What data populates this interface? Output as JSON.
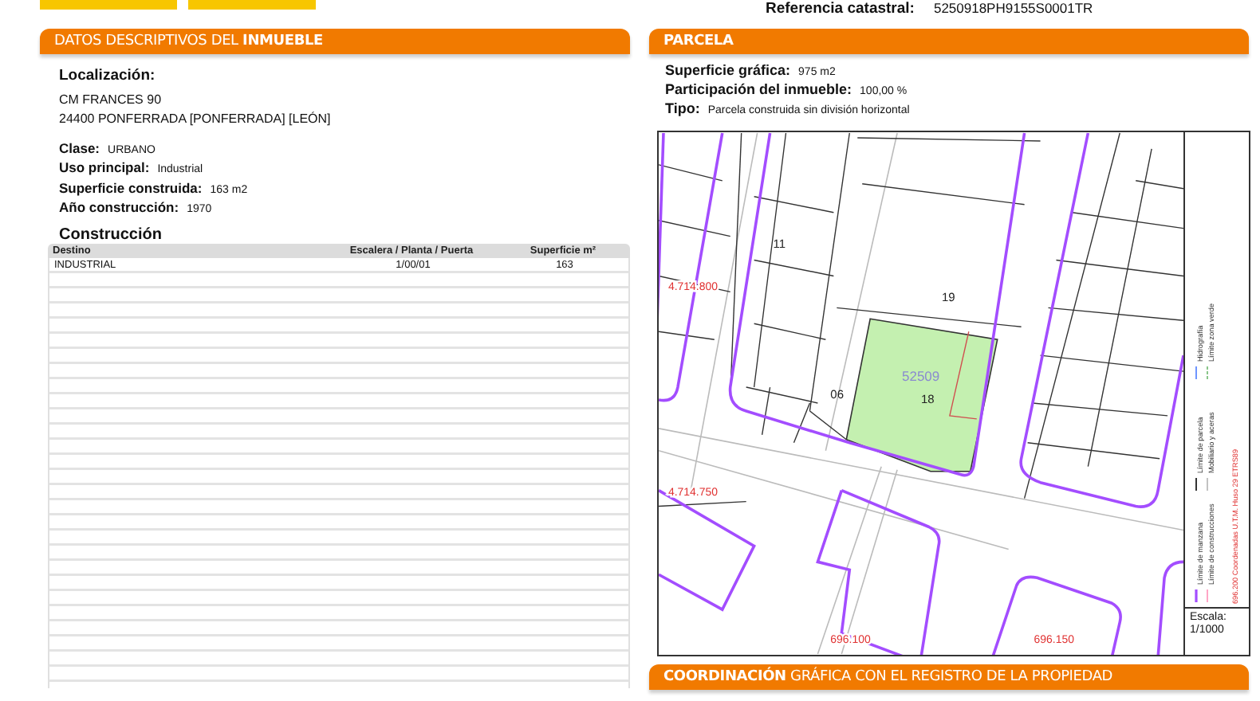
{
  "header": {
    "reference_label": "Referencia catastral:",
    "reference_value": "5250918PH9155S0001TR"
  },
  "left_panel": {
    "title": "DATOS DESCRIPTIVOS DEL **INMUEBLE**",
    "location_label": "Localización:",
    "address_lines": [
      "CM FRANCES 90",
      "24400 PONFERRADA [PONFERRADA] [LEÓN]"
    ],
    "fields": [
      {
        "label": "Clase:",
        "value": "URBANO"
      },
      {
        "label": "Uso principal:",
        "value": "Industrial"
      },
      {
        "label": "Superficie construida:",
        "value": "163 m2"
      },
      {
        "label": "Año construcción:",
        "value": "1970"
      }
    ],
    "construction": {
      "title": "Construcción",
      "columns": [
        "Destino",
        "Escalera / Planta / Puerta",
        "Superficie m²"
      ],
      "rows": [
        [
          "INDUSTRIAL",
          "1/00/01",
          "163"
        ]
      ]
    }
  },
  "right_panel": {
    "title": "PARCELA",
    "fields": [
      {
        "label": "Superficie gráfica:",
        "value": "975 m2"
      },
      {
        "label": "Participación del inmueble:",
        "value": "100,00 %"
      },
      {
        "label": "Tipo:",
        "value": "Parcela construida sin división horizontal"
      }
    ],
    "map": {
      "labels": [
        {
          "text": "19",
          "kind": "parcel"
        },
        {
          "text": "52509",
          "kind": "block"
        },
        {
          "text": "18",
          "kind": "parcel"
        },
        {
          "text": "11",
          "kind": "parcel"
        },
        {
          "text": "06",
          "kind": "parcel"
        },
        {
          "text": "4.714.800",
          "kind": "coordinate"
        },
        {
          "text": "4.714.750",
          "kind": "coordinate"
        },
        {
          "text": "696.100",
          "kind": "coordinate"
        },
        {
          "text": "696.150",
          "kind": "coordinate"
        }
      ],
      "legend": [
        {
          "text": "Límite de manzana",
          "kind": "block"
        },
        {
          "text": "Límite de construcciones",
          "kind": "building"
        },
        {
          "text": "Límite de parcela",
          "kind": "parcel"
        },
        {
          "text": "Mobiliario y aceras",
          "kind": "street"
        },
        {
          "text": "Hidrografía",
          "kind": "water"
        },
        {
          "text": "Límite zona verde",
          "kind": "green"
        }
      ],
      "coordinates_note": "696.200 Coordenadas U.T.M. Huso 29 ETRS89",
      "scale_label": "Escala:",
      "scale_value": "1/1000"
    }
  },
  "bottom_panel": {
    "title": "**COORDINACIÓN** GRÁFICA CON EL REGISTRO DE LA PROPIEDAD"
  }
}
